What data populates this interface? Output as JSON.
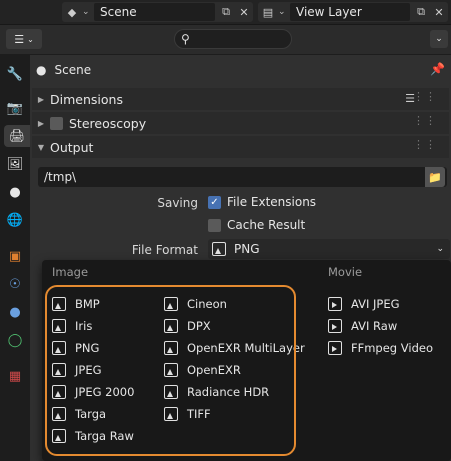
{
  "topbar": {
    "scene": {
      "name": "Scene"
    },
    "view_layer": {
      "name": "View Layer"
    }
  },
  "header": {
    "search": {
      "placeholder": ""
    }
  },
  "context": {
    "scene_label": "Scene"
  },
  "panels": {
    "dimensions": "Dimensions",
    "stereoscopy": "Stereoscopy",
    "output": "Output"
  },
  "output": {
    "path": "/tmp\\",
    "saving_label": "Saving",
    "file_extensions_label": "File Extensions",
    "file_extensions_checked": true,
    "cache_result_label": "Cache Result",
    "cache_result_checked": false,
    "file_format_label": "File Format",
    "file_format_value": "PNG"
  },
  "menu": {
    "image_title": "Image",
    "movie_title": "Movie",
    "image_col1": [
      "BMP",
      "Iris",
      "PNG",
      "JPEG",
      "JPEG 2000",
      "Targa",
      "Targa Raw"
    ],
    "image_col2": [
      "Cineon",
      "DPX",
      "OpenEXR MultiLayer",
      "OpenEXR",
      "Radiance HDR",
      "TIFF"
    ],
    "movie": [
      "AVI JPEG",
      "AVI Raw",
      "FFmpeg Video"
    ]
  },
  "colors": {
    "accent": "#4772b3",
    "annotation": "#e48a30"
  }
}
